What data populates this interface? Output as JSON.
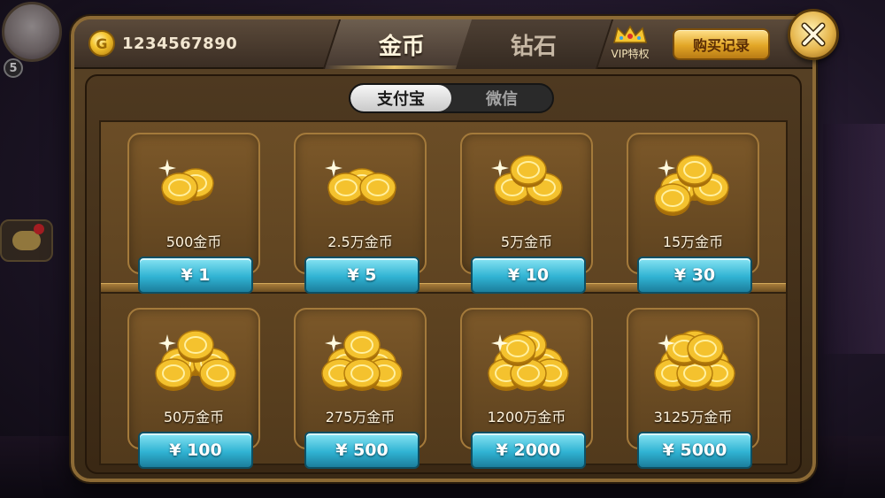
{
  "colors": {
    "gold": "#e8b53a",
    "price_button": "#30b3d3",
    "panel_bg": "#5a4326"
  },
  "balance": {
    "value": "1234567890",
    "icon": "gold-coin-icon"
  },
  "tabs": {
    "gold": "金币",
    "diamond": "钻石"
  },
  "vip": {
    "label": "VIP特权",
    "icon": "crown-icon"
  },
  "buttons": {
    "history": "购买记录",
    "close_icon": "close-icon"
  },
  "pay_methods": {
    "alipay": "支付宝",
    "wechat": "微信",
    "selected": "支付宝"
  },
  "items": [
    {
      "amount": "500金币",
      "price": "¥ 1",
      "coins": 1
    },
    {
      "amount": "2.5万金币",
      "price": "¥ 5",
      "coins": 2
    },
    {
      "amount": "5万金币",
      "price": "¥ 10",
      "coins": 3
    },
    {
      "amount": "15万金币",
      "price": "¥ 30",
      "coins": 4
    },
    {
      "amount": "50万金币",
      "price": "¥ 100",
      "coins": 5
    },
    {
      "amount": "275万金币",
      "price": "¥ 500",
      "coins": 6
    },
    {
      "amount": "1200万金币",
      "price": "¥ 2000",
      "coins": 7
    },
    {
      "amount": "3125万金币",
      "price": "¥ 5000",
      "coins": 8
    }
  ]
}
